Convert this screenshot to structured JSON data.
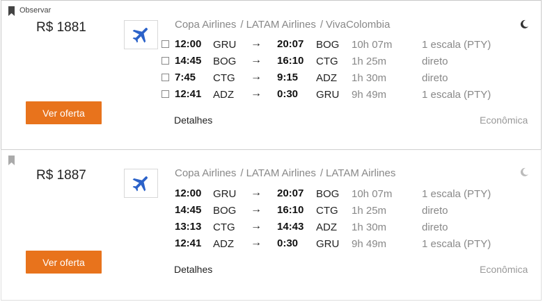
{
  "results": [
    {
      "watch_label": "Observar",
      "price": "R$ 1881",
      "airlines": [
        "Copa Airlines",
        "LATAM Airlines",
        "VivaColombia"
      ],
      "show_checkboxes": true,
      "moon_color": "#333333",
      "legs": [
        {
          "dep": "12:00",
          "from": "GRU",
          "arr": "20:07",
          "to": "BOG",
          "duration": "10h 07m",
          "stops": "1 escala (PTY)"
        },
        {
          "dep": "14:45",
          "from": "BOG",
          "arr": "16:10",
          "to": "CTG",
          "duration": "1h 25m",
          "stops": "direto"
        },
        {
          "dep": "7:45",
          "from": "CTG",
          "arr": "9:15",
          "to": "ADZ",
          "duration": "1h 30m",
          "stops": "direto"
        },
        {
          "dep": "12:41",
          "from": "ADZ",
          "arr": "0:30",
          "to": "GRU",
          "duration": "9h 49m",
          "stops": "1 escala (PTY)"
        }
      ],
      "button_label": "Ver oferta",
      "details_label": "Detalhes",
      "cabin": "Econômica"
    },
    {
      "watch_label": "",
      "price": "R$ 1887",
      "airlines": [
        "Copa Airlines",
        "LATAM Airlines",
        "LATAM Airlines"
      ],
      "show_checkboxes": false,
      "moon_color": "#bbbbbb",
      "legs": [
        {
          "dep": "12:00",
          "from": "GRU",
          "arr": "20:07",
          "to": "BOG",
          "duration": "10h 07m",
          "stops": "1 escala (PTY)"
        },
        {
          "dep": "14:45",
          "from": "BOG",
          "arr": "16:10",
          "to": "CTG",
          "duration": "1h 25m",
          "stops": "direto"
        },
        {
          "dep": "13:13",
          "from": "CTG",
          "arr": "14:43",
          "to": "ADZ",
          "duration": "1h 30m",
          "stops": "direto"
        },
        {
          "dep": "12:41",
          "from": "ADZ",
          "arr": "0:30",
          "to": "GRU",
          "duration": "9h 49m",
          "stops": "1 escala (PTY)"
        }
      ],
      "button_label": "Ver oferta",
      "details_label": "Detalhes",
      "cabin": "Econômica"
    }
  ],
  "icons": {
    "bookmark": "bookmark-icon",
    "airline_logo": "plane-icon",
    "overnight": "moon-icon",
    "arrow": "→"
  },
  "colors": {
    "accent": "#e8731c",
    "plane": "#2b62c9"
  }
}
